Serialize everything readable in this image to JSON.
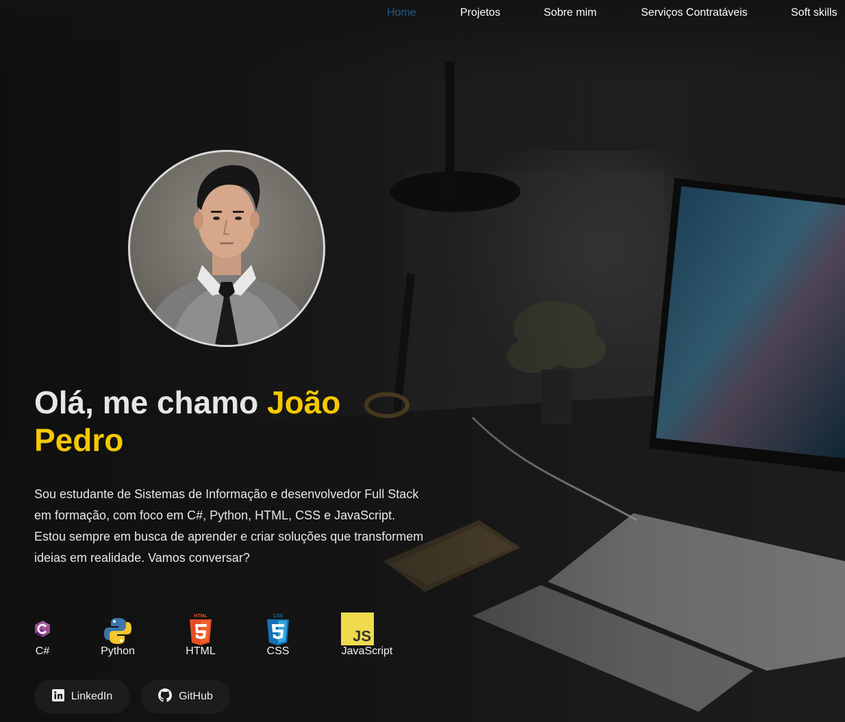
{
  "nav": {
    "items": [
      {
        "label": "Home",
        "active": true
      },
      {
        "label": "Projetos",
        "active": false
      },
      {
        "label": "Sobre mim",
        "active": false
      },
      {
        "label": "Serviços Contratáveis",
        "active": false
      },
      {
        "label": "Soft skills",
        "active": false
      }
    ]
  },
  "hero": {
    "greeting": "Olá, me chamo ",
    "name_first": "João",
    "name_last": "Pedro",
    "bio": "Sou estudante de Sistemas de Informação e desenvolvedor Full Stack em formação, com foco em C#, Python, HTML, CSS e JavaScript. Estou sempre em busca de aprender e criar soluções que transformem ideias em realidade. Vamos conversar?"
  },
  "technologies": [
    {
      "label": "C#",
      "icon": "csharp-icon"
    },
    {
      "label": "Python",
      "icon": "python-icon"
    },
    {
      "label": "HTML",
      "icon": "html5-icon"
    },
    {
      "label": "CSS",
      "icon": "css3-icon"
    },
    {
      "label": "JavaScript",
      "icon": "javascript-icon"
    }
  ],
  "social": [
    {
      "label": "LinkedIn",
      "icon": "linkedin-icon"
    },
    {
      "label": "GitHub",
      "icon": "github-icon"
    }
  ],
  "colors": {
    "accent": "#f5c800",
    "nav_active": "#1f5d8c",
    "button_bg": "#1c1c1c"
  }
}
